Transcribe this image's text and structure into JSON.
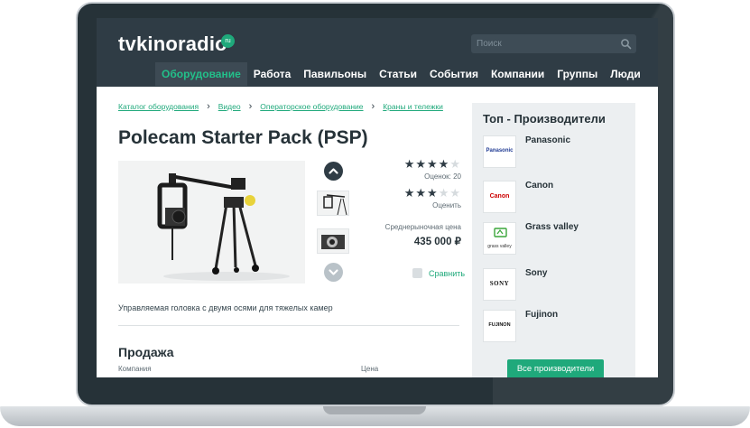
{
  "site": {
    "logo": "tvkinoradio",
    "logo_badge": "ru"
  },
  "search": {
    "placeholder": "Поиск"
  },
  "nav": [
    {
      "label": "Оборудование",
      "active": true
    },
    {
      "label": "Работа"
    },
    {
      "label": "Павильоны"
    },
    {
      "label": "Статьи"
    },
    {
      "label": "События"
    },
    {
      "label": "Компании"
    },
    {
      "label": "Группы"
    },
    {
      "label": "Люди"
    }
  ],
  "breadcrumb": [
    "Каталог оборудования",
    "Видео",
    "Операторское оборудование",
    "Краны и тележки"
  ],
  "product": {
    "title": "Polecam Starter Pack (PSP)",
    "rating_stars": 4,
    "rating_count_label": "Оценок: 20",
    "user_rating_stars": 3,
    "rate_label": "Оценить",
    "price_label": "Среднерыночная цена",
    "price": "435 000 ₽",
    "compare_label": "Сравнить",
    "description": "Управляемая головка с двумя осями для тяжелых камер"
  },
  "sale": {
    "title": "Продажа",
    "col_company": "Компания",
    "col_price": "Цена"
  },
  "sidebar": {
    "title": "Топ - Производители",
    "makers": [
      {
        "name": "Panasonic",
        "logo_text": "Panasonic"
      },
      {
        "name": "Canon",
        "logo_text": "Canon"
      },
      {
        "name": "Grass valley",
        "logo_text": "grass valley"
      },
      {
        "name": "Sony",
        "logo_text": "SONY"
      },
      {
        "name": "Fujinon",
        "logo_text": "FUJINON"
      }
    ],
    "all_button": "Все производители"
  },
  "colors": {
    "accent": "#1fa97b",
    "header": "#2f3c45",
    "sidebar_bg": "#eceff1",
    "canon_red": "#cc0000"
  }
}
